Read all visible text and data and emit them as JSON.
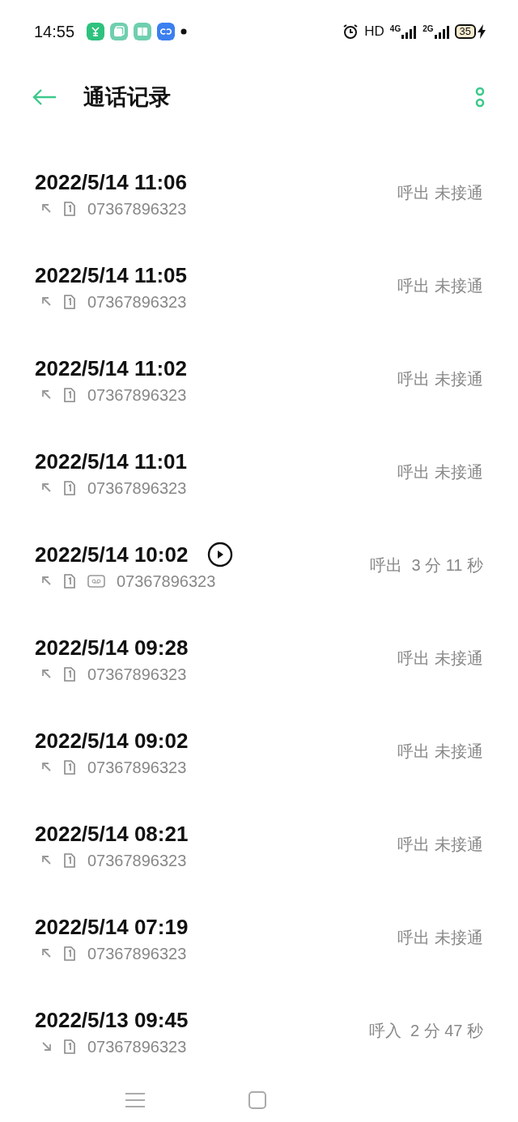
{
  "status_bar": {
    "time": "14:55",
    "network": [
      {
        "label": "4G"
      },
      {
        "label": "2G"
      }
    ],
    "hd": "HD",
    "battery": "35",
    "charging": true
  },
  "header": {
    "title": "通话记录"
  },
  "calls": [
    {
      "time": "2022/5/14 11:06",
      "kind": "outgoing",
      "number": "07367896323",
      "status": "呼出 未接通",
      "recording": false
    },
    {
      "time": "2022/5/14 11:05",
      "kind": "outgoing",
      "number": "07367896323",
      "status": "呼出 未接通",
      "recording": false
    },
    {
      "time": "2022/5/14 11:02",
      "kind": "outgoing",
      "number": "07367896323",
      "status": "呼出 未接通",
      "recording": false
    },
    {
      "time": "2022/5/14 11:01",
      "kind": "outgoing",
      "number": "07367896323",
      "status": "呼出 未接通",
      "recording": false
    },
    {
      "time": "2022/5/14 10:02",
      "kind": "outgoing",
      "number": "07367896323",
      "status": "呼出  3 分 11 秒",
      "recording": true
    },
    {
      "time": "2022/5/14 09:28",
      "kind": "outgoing",
      "number": "07367896323",
      "status": "呼出 未接通",
      "recording": false
    },
    {
      "time": "2022/5/14 09:02",
      "kind": "outgoing",
      "number": "07367896323",
      "status": "呼出 未接通",
      "recording": false
    },
    {
      "time": "2022/5/14 08:21",
      "kind": "outgoing",
      "number": "07367896323",
      "status": "呼出 未接通",
      "recording": false
    },
    {
      "time": "2022/5/14 07:19",
      "kind": "outgoing",
      "number": "07367896323",
      "status": "呼出 未接通",
      "recording": false
    },
    {
      "time": "2022/5/13 09:45",
      "kind": "incoming",
      "number": "07367896323",
      "status": "呼入  2 分 47 秒",
      "recording": false
    }
  ]
}
